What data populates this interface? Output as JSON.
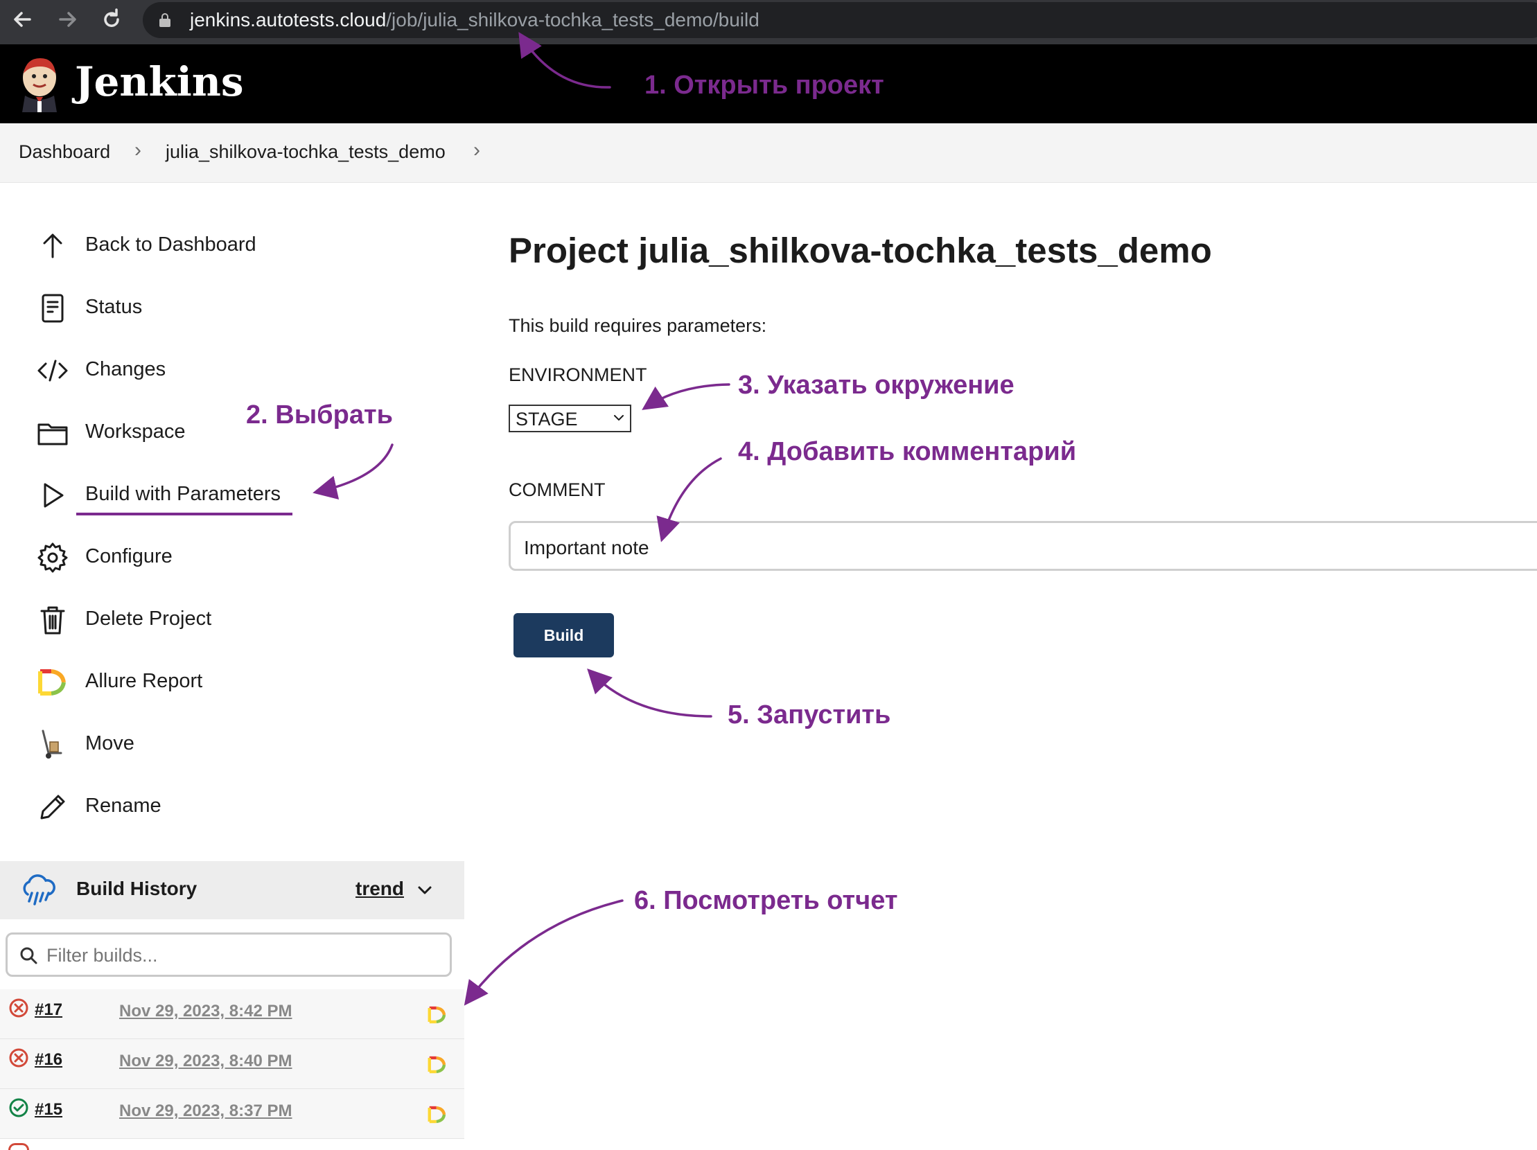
{
  "browser": {
    "url_host": "jenkins.autotests.cloud",
    "url_path": "/job/julia_shilkova-tochka_tests_demo/build"
  },
  "header": {
    "brand": "Jenkins"
  },
  "breadcrumb": {
    "items": [
      "Dashboard",
      "julia_shilkova-tochka_tests_demo"
    ]
  },
  "sidebar": {
    "items": [
      {
        "label": "Back to Dashboard",
        "icon": "arrow-up-icon"
      },
      {
        "label": "Status",
        "icon": "document-icon"
      },
      {
        "label": "Changes",
        "icon": "code-icon"
      },
      {
        "label": "Workspace",
        "icon": "folder-icon"
      },
      {
        "label": "Build with Parameters",
        "icon": "play-icon"
      },
      {
        "label": "Configure",
        "icon": "gear-icon"
      },
      {
        "label": "Delete Project",
        "icon": "trash-icon"
      },
      {
        "label": "Allure Report",
        "icon": "allure-icon"
      },
      {
        "label": "Move",
        "icon": "hand-truck-icon"
      },
      {
        "label": "Rename",
        "icon": "pencil-icon"
      }
    ]
  },
  "build_history": {
    "title": "Build History",
    "trend_label": "trend",
    "filter_placeholder": "Filter builds...",
    "builds": [
      {
        "number": "#17",
        "date": "Nov 29, 2023, 8:42 PM",
        "status": "failed",
        "status_color": "#d24939"
      },
      {
        "number": "#16",
        "date": "Nov 29, 2023, 8:40 PM",
        "status": "failed",
        "status_color": "#d24939"
      },
      {
        "number": "#15",
        "date": "Nov 29, 2023, 8:37 PM",
        "status": "success",
        "status_color": "#138347"
      }
    ]
  },
  "main": {
    "title": "Project julia_shilkova-tochka_tests_demo",
    "requires_text": "This build requires parameters:",
    "environment_label": "ENVIRONMENT",
    "environment_value": "STAGE",
    "comment_label": "COMMENT",
    "comment_value": "Important note",
    "build_button": "Build"
  },
  "annotations": {
    "step1": "1. Открыть проект",
    "step2": "2. Выбрать",
    "step3": "3. Указать окружение",
    "step4": "4. Добавить комментарий",
    "step5": "5. Запустить",
    "step6": "6. Посмотреть отчет"
  },
  "colors": {
    "annotation": "#7b2a8e",
    "build_button": "#1c3a5e",
    "header_bg": "#000000"
  }
}
